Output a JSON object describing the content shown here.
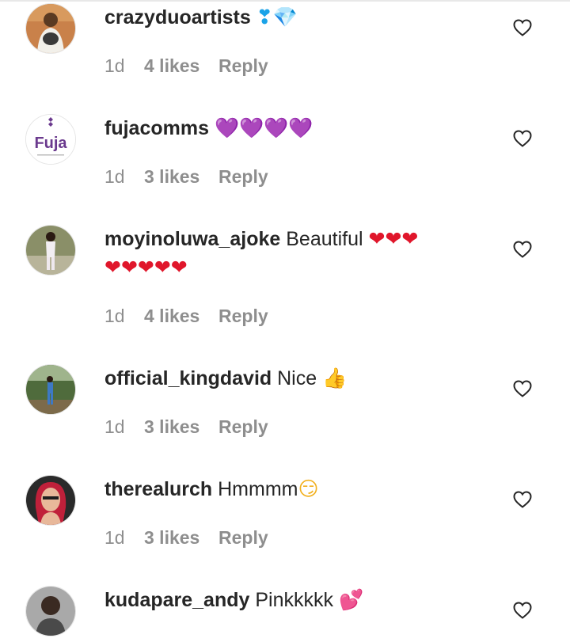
{
  "comments": [
    {
      "username": "crazyduoartists",
      "text": "",
      "emoji": "❣💎",
      "emoji_color": "#1aa3e8",
      "text_line2": "",
      "time": "1d",
      "likes": "4 likes",
      "reply": "Reply",
      "avatar_icon": "avatar-photo-man-white-robe"
    },
    {
      "username": "fujacomms",
      "text": "",
      "emoji": "💜💜💜💜",
      "emoji_color": "#7b1fd1",
      "text_line2": "",
      "time": "1d",
      "likes": "3 likes",
      "reply": "Reply",
      "avatar_logo_text": "Fuja",
      "avatar_icon": "fuja-logo"
    },
    {
      "username": "moyinoluwa_ajoke",
      "text": "Beautiful",
      "emoji": "❤❤❤",
      "emoji_color": "#e0162b",
      "text_line2": "❤❤❤❤❤",
      "time": "1d",
      "likes": "4 likes",
      "reply": "Reply",
      "avatar_icon": "avatar-photo-woman"
    },
    {
      "username": "official_kingdavid",
      "text": "Nice",
      "emoji": "👍",
      "emoji_color": "#5a3320",
      "text_line2": "",
      "time": "1d",
      "likes": "3 likes",
      "reply": "Reply",
      "avatar_icon": "avatar-photo-man-outdoors"
    },
    {
      "username": "therealurch",
      "text": "Hmmmm",
      "emoji": "😏",
      "emoji_color": "#f2b01e",
      "text_line2": "",
      "time": "1d",
      "likes": "3 likes",
      "reply": "Reply",
      "avatar_icon": "avatar-photo-woman-red-hair"
    },
    {
      "username": "kudapare_andy",
      "text": "Pinkkkkk",
      "emoji": "💕",
      "emoji_color": "#e8326a",
      "text_line2": "",
      "time": "",
      "likes": "",
      "reply": "",
      "avatar_icon": "avatar-photo-man"
    }
  ],
  "icons": {
    "like": "heart-outline-icon"
  },
  "colors": {
    "text": "#262626",
    "meta": "#8e8e8e"
  }
}
